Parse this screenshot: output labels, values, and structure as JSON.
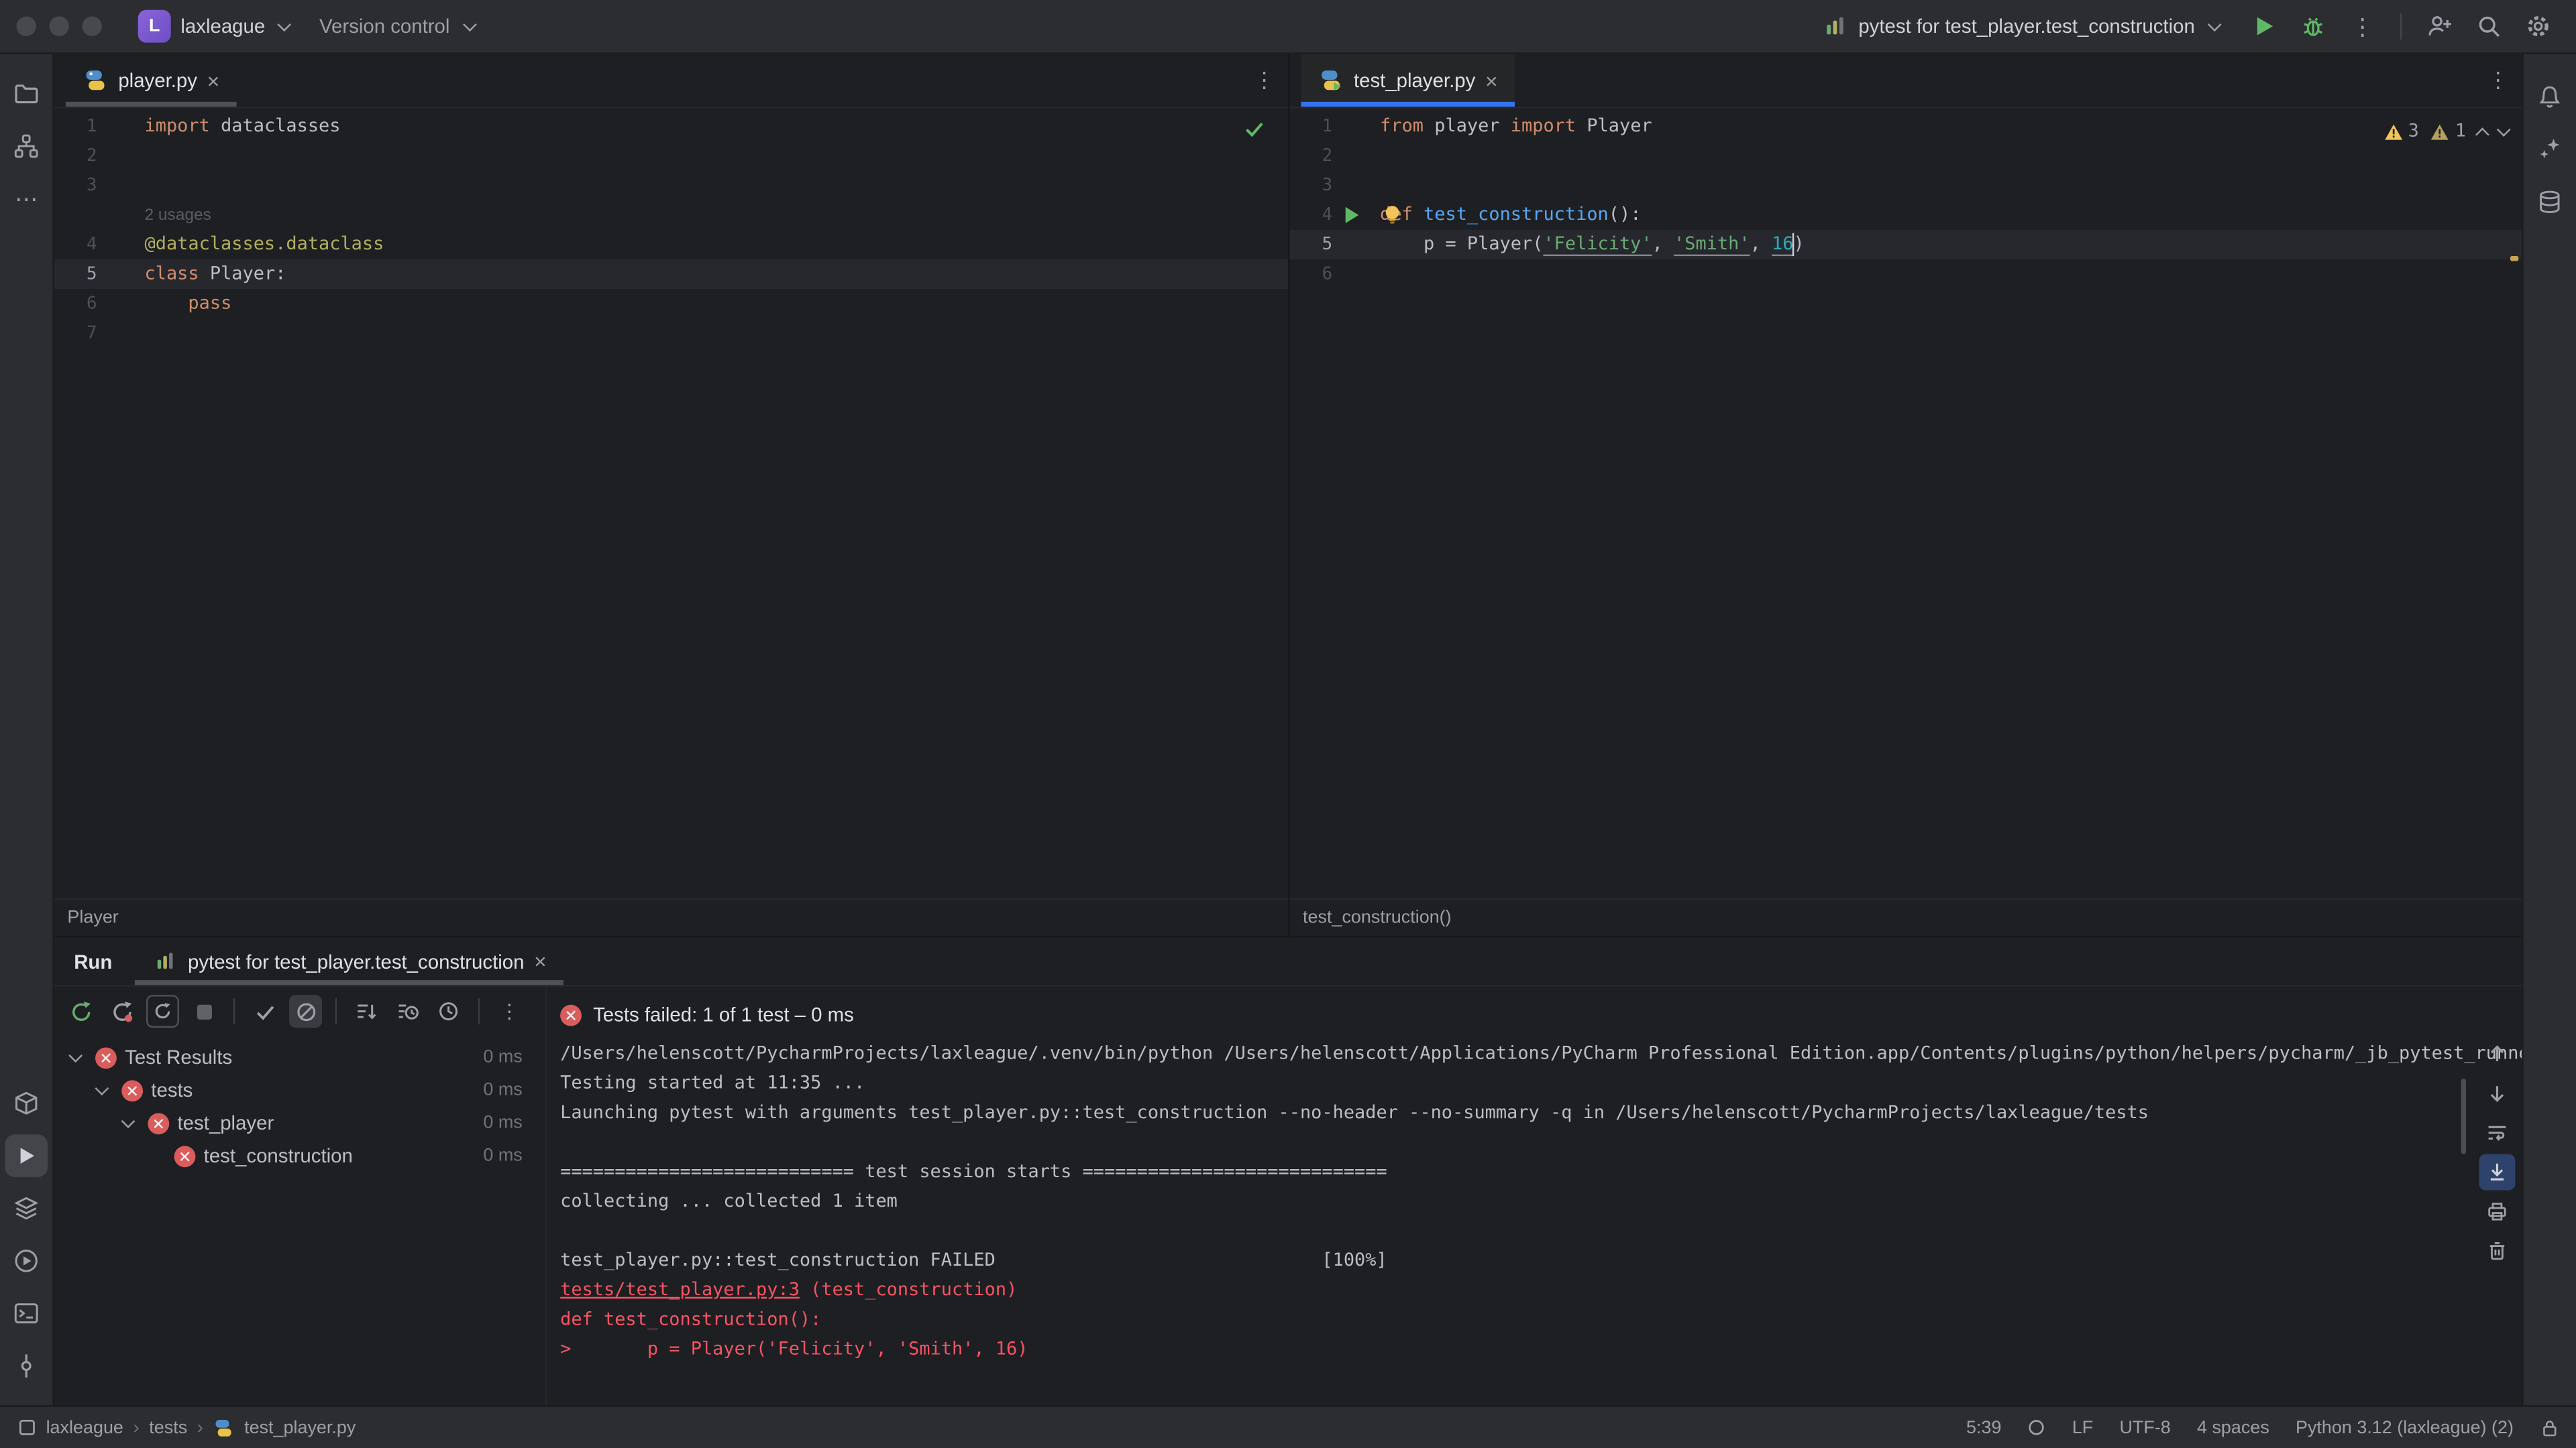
{
  "icons": {
    "close": "×",
    "more_vertical": "⋮",
    "more_horizontal": "⋯"
  },
  "titlebar": {
    "project_badge_letter": "L",
    "project_name": "laxleague",
    "version_control_label": "Version control",
    "run_config_label": "pytest for test_player.test_construction"
  },
  "editors": {
    "left": {
      "tab": "player.py",
      "breadcrumb": "Player",
      "lines": [
        {
          "n": "1",
          "tokens": [
            [
              "kw",
              "import"
            ],
            [
              "pl",
              " dataclasses"
            ]
          ]
        },
        {
          "n": "2",
          "tokens": []
        },
        {
          "n": "3",
          "tokens": []
        },
        {
          "inlay": "2 usages"
        },
        {
          "n": "4",
          "tokens": [
            [
              "dec",
              "@dataclasses.dataclass"
            ]
          ]
        },
        {
          "n": "5",
          "current": true,
          "tokens": [
            [
              "kw",
              "class"
            ],
            [
              "pl",
              " Player:"
            ]
          ]
        },
        {
          "n": "6",
          "tokens": [
            [
              "pl",
              "    "
            ],
            [
              "kw",
              "pass"
            ]
          ]
        },
        {
          "n": "7",
          "tokens": []
        }
      ]
    },
    "right": {
      "tab": "test_player.py",
      "breadcrumb": "test_construction()",
      "warning_count_1": "3",
      "warning_count_2": "1",
      "lines": [
        {
          "n": "1",
          "tokens": [
            [
              "kw",
              "from"
            ],
            [
              "pl",
              " player "
            ],
            [
              "kw",
              "import"
            ],
            [
              "pl",
              " Player"
            ]
          ]
        },
        {
          "n": "2",
          "tokens": []
        },
        {
          "n": "3",
          "tokens": []
        },
        {
          "n": "4",
          "icon": "run",
          "tokens": [
            [
              "kw",
              "def"
            ],
            [
              "fn",
              " test_construction"
            ],
            [
              "pl",
              "():"
            ]
          ]
        },
        {
          "n": "5",
          "current": true,
          "tokens": [
            [
              "pl",
              "    p = Player("
            ],
            [
              "stru",
              "'Felicity'"
            ],
            [
              "pl",
              ", "
            ],
            [
              "stru",
              "'Smith'"
            ],
            [
              "pl",
              ", "
            ],
            [
              "numu",
              "16"
            ],
            [
              "caret",
              ""
            ],
            [
              "pl",
              ")"
            ]
          ]
        },
        {
          "n": "6",
          "tokens": []
        }
      ]
    }
  },
  "run_panel": {
    "window_title": "Run",
    "tab_label": "pytest for test_player.test_construction",
    "tree": [
      {
        "level": 0,
        "chevron": true,
        "label": "Test Results",
        "time": "0 ms"
      },
      {
        "level": 1,
        "chevron": true,
        "label": "tests",
        "time": "0 ms"
      },
      {
        "level": 2,
        "chevron": true,
        "label": "test_player",
        "time": "0 ms"
      },
      {
        "level": 3,
        "chevron": false,
        "label": "test_construction",
        "time": "0 ms"
      }
    ],
    "summary": "Tests failed: 1 of 1 test – 0 ms",
    "console": [
      [
        [
          "pl",
          "/Users/helenscott/PycharmProjects/laxleague/.venv/bin/python /Users/helenscott/Applications/PyCharm Professional Edition.app/Contents/plugins/python/helpers/pycharm/_jb_pytest_runner.py"
        ]
      ],
      [
        [
          "pl",
          "Testing started at 11:35 ..."
        ]
      ],
      [
        [
          "pl",
          "Launching pytest with arguments test_player.py::test_construction --no-header --no-summary -q in /Users/helenscott/PycharmProjects/laxleague/tests"
        ]
      ],
      [],
      [
        [
          "pl",
          "=========================== test session starts ============================"
        ]
      ],
      [
        [
          "pl",
          "collecting ... collected 1 item"
        ]
      ],
      [],
      [
        [
          "pl",
          "test_player.py::test_construction FAILED                              [100%]"
        ]
      ],
      [
        [
          "link",
          "tests/test_player.py:3"
        ],
        [
          "red",
          " (test_construction)"
        ]
      ],
      [
        [
          "red",
          "def test_construction():"
        ]
      ],
      [
        [
          "red",
          ">       p = Player('Felicity', 'Smith', 16)"
        ]
      ]
    ]
  },
  "statusbar": {
    "crumb_project": "laxleague",
    "crumb_dir": "tests",
    "crumb_file": "test_player.py",
    "separator": "›",
    "caret_position": "5:39",
    "line_separator": "LF",
    "encoding": "UTF-8",
    "indent": "4 spaces",
    "interpreter": "Python 3.12 (laxleague) (2)"
  }
}
